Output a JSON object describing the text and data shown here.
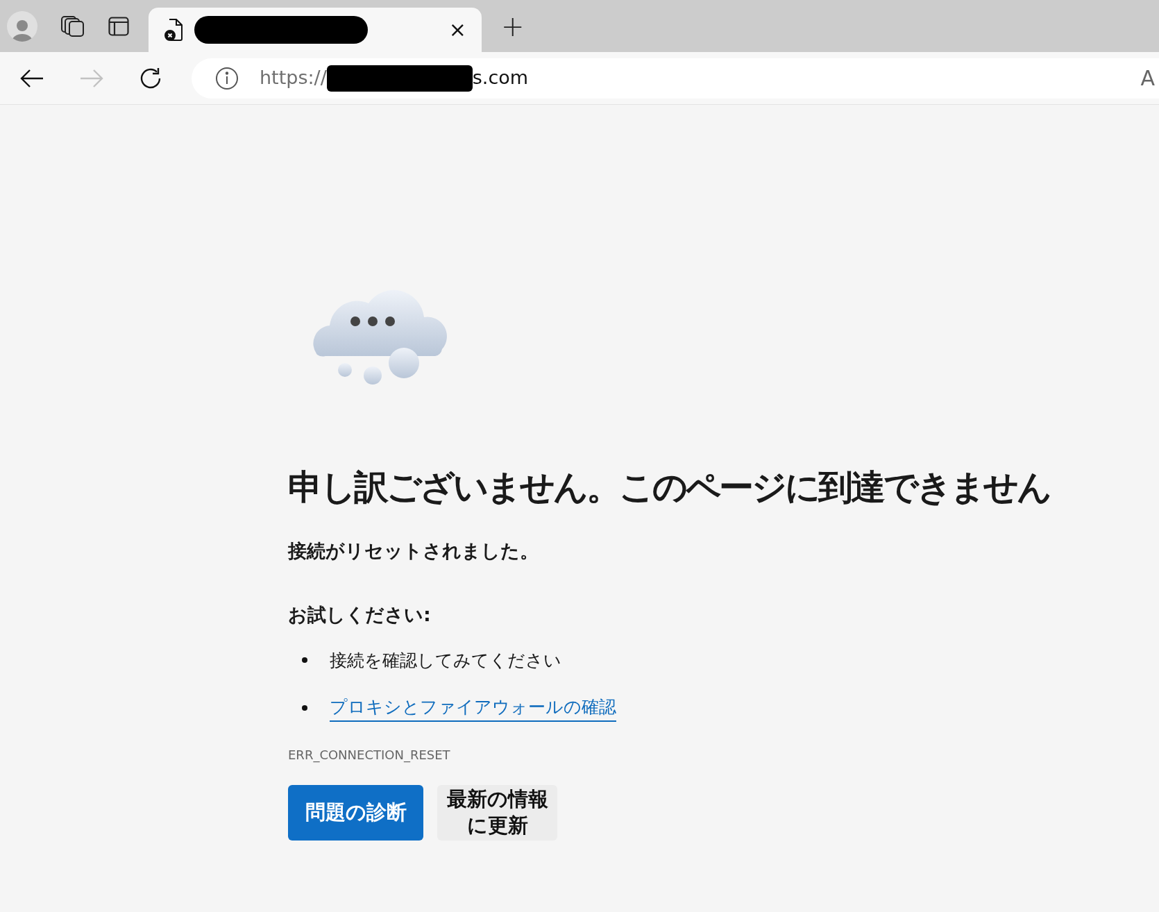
{
  "tab": {
    "selected": true,
    "close": "×"
  },
  "new_tab": "+",
  "address_bar": {
    "url_start": "https://",
    "url_end": "s.com",
    "edge_text": "A"
  },
  "error": {
    "heading": "申し訳ございません。このページに到達できません",
    "message": "接続がリセットされました。",
    "try_heading": "お試しください:",
    "suggestions": [
      {
        "kind": "text",
        "text": "接続を確認してみてください"
      },
      {
        "kind": "link",
        "text": "プロキシとファイアウォールの確認"
      }
    ],
    "code": "ERR_CONNECTION_RESET"
  },
  "buttons": [
    {
      "kind": "primary",
      "label": "問題の診断"
    },
    {
      "kind": "secondary",
      "label": "最新の情報に更新"
    }
  ]
}
